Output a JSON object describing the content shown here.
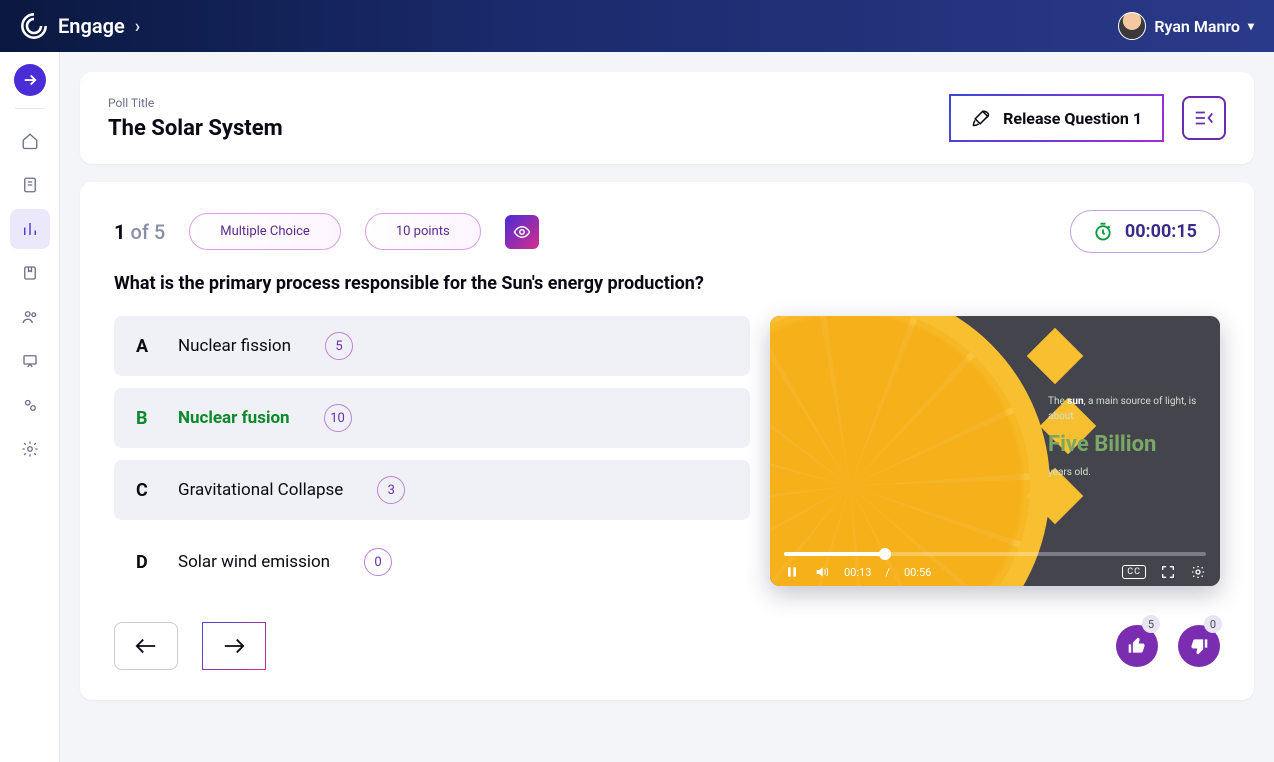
{
  "header": {
    "brand": "Engage",
    "user_name": "Ryan Manro"
  },
  "title_card": {
    "label": "Poll Title",
    "title": "The Solar System",
    "release_label": "Release Question 1"
  },
  "question": {
    "index": "1",
    "of_label": "of",
    "total": "5",
    "type_pill": "Multiple Choice",
    "points_pill": "10 points",
    "timer": "00:00:15",
    "text": "What is the primary process responsible for the Sun's energy production?",
    "answers": [
      {
        "letter": "A",
        "text": "Nuclear fission",
        "count": "5",
        "bg": true,
        "correct": false
      },
      {
        "letter": "B",
        "text": "Nuclear fusion",
        "count": "10",
        "bg": true,
        "correct": true
      },
      {
        "letter": "C",
        "text": "Gravitational Collapse",
        "count": "3",
        "bg": true,
        "correct": false
      },
      {
        "letter": "D",
        "text": "Solar wind emission",
        "count": "0",
        "bg": false,
        "correct": false
      }
    ]
  },
  "video": {
    "text_pre": "The ",
    "text_bold": "sun",
    "text_mid": ", a main source of light, is about",
    "text_big": "Five Billion",
    "text_post": "years old.",
    "time_current": "00:13",
    "time_sep": "/",
    "time_total": "00:56",
    "cc": "CC"
  },
  "feedback": {
    "up": "5",
    "down": "0"
  }
}
